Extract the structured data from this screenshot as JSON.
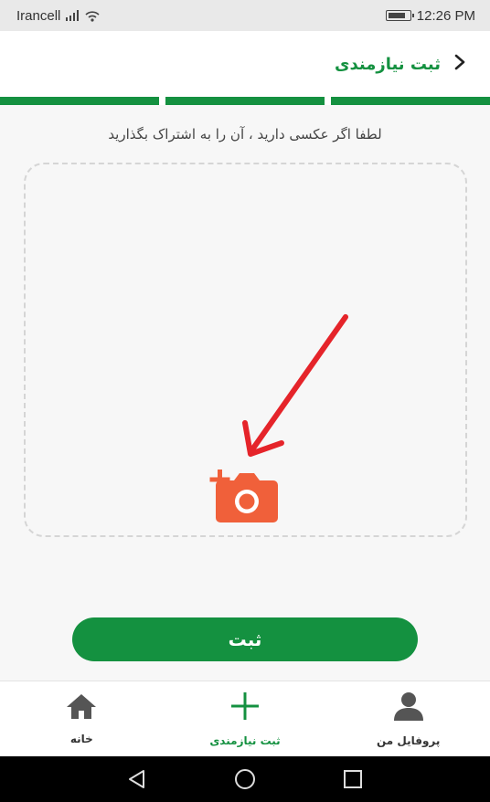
{
  "status_bar": {
    "carrier": "Irancell",
    "time": "12:26 PM"
  },
  "header": {
    "title": "ثبت نیازمندی",
    "back_icon": "chevron-left-icon"
  },
  "progress": {
    "steps_total": 3,
    "steps_completed": 3,
    "color": "#149140"
  },
  "upload": {
    "hint": "لطفا اگر عکسی دارید ، آن را به اشتراک بگذارید",
    "camera_icon": "add-photo-icon",
    "camera_color": "#f0603a",
    "arrow_color": "#e5242a"
  },
  "submit": {
    "label": "ثبت"
  },
  "bottom_nav": {
    "items": [
      {
        "label": "خانه",
        "icon": "home-icon",
        "active": false
      },
      {
        "label": "ثبت نیازمندی",
        "icon": "plus-icon",
        "active": true
      },
      {
        "label": "پروفایل من",
        "icon": "user-icon",
        "active": false
      }
    ]
  },
  "colors": {
    "brand_green": "#149140",
    "background": "#f7f7f7"
  }
}
